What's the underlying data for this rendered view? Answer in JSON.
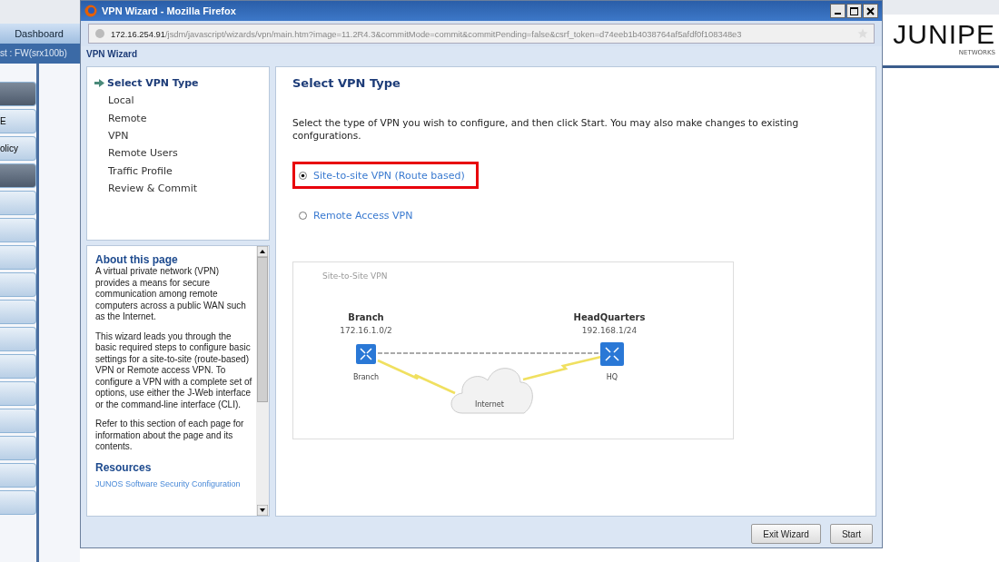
{
  "background_app": {
    "tab": "Dashboard",
    "device": "st : FW(srx100b)",
    "side_buttons": [
      {
        "selected": true
      },
      {
        "label": "E",
        "selected": false
      },
      {
        "label": "olicy",
        "selected": false
      },
      {
        "selected": true
      },
      {
        "selected": false
      },
      {
        "selected": false
      },
      {
        "selected": false
      },
      {
        "selected": false
      },
      {
        "selected": false
      },
      {
        "selected": false
      },
      {
        "selected": false
      },
      {
        "selected": false
      },
      {
        "selected": false
      },
      {
        "selected": false
      },
      {
        "selected": false
      },
      {
        "selected": false
      }
    ],
    "logo": "JUNIPE",
    "logo_sub": "NETWORKS"
  },
  "window": {
    "title": "VPN Wizard - Mozilla Firefox",
    "url_host": "172.16.254.91",
    "url_path": "/jsdm/javascript/wizards/vpn/main.htm?image=11.2R4.3&commitMode=commit&commitPending=false&csrf_token=d74eeb1b4038764af5afdf0f108348e3",
    "header": "VPN Wizard"
  },
  "steps": [
    {
      "label": "Select VPN Type",
      "selected": true
    },
    {
      "label": "Local",
      "selected": false
    },
    {
      "label": "Remote",
      "selected": false
    },
    {
      "label": "VPN",
      "selected": false
    },
    {
      "label": "Remote Users",
      "selected": false
    },
    {
      "label": "Traffic Profile",
      "selected": false
    },
    {
      "label": "Review & Commit",
      "selected": false
    }
  ],
  "about": {
    "title": "About this page",
    "paragraphs": [
      "A virtual private network (VPN) provides a means for secure communication among remote computers across a public WAN such as the Internet.",
      "This wizard leads you through the basic required steps to configure basic settings for a site-to-site (route-based) VPN or Remote access VPN. To configure a VPN with a complete set of options, use either the J-Web interface or the command-line interface (CLI).",
      "Refer to this section of each page for information about the page and its contents."
    ],
    "resources_title": "Resources",
    "resources_link": "JUNOS Software Security Configuration"
  },
  "main": {
    "title": "Select VPN Type",
    "description": "Select the type of VPN you wish to configure, and then click Start. You may also make changes to existing confgurations.",
    "options": [
      {
        "label": "Site-to-site VPN (Route based)",
        "selected": true,
        "highlighted": true
      },
      {
        "label": "Remote Access VPN",
        "selected": false,
        "highlighted": false
      }
    ],
    "diagram": {
      "title": "Site-to-Site VPN",
      "left": {
        "name": "Branch",
        "subnet": "172.16.1.0/2",
        "label": "Branch"
      },
      "right": {
        "name": "HeadQuarters",
        "subnet": "192.168.1/24",
        "label": "HQ"
      },
      "cloud": "Internet"
    }
  },
  "buttons": [
    {
      "label": "Exit Wizard"
    },
    {
      "label": "Start"
    }
  ]
}
